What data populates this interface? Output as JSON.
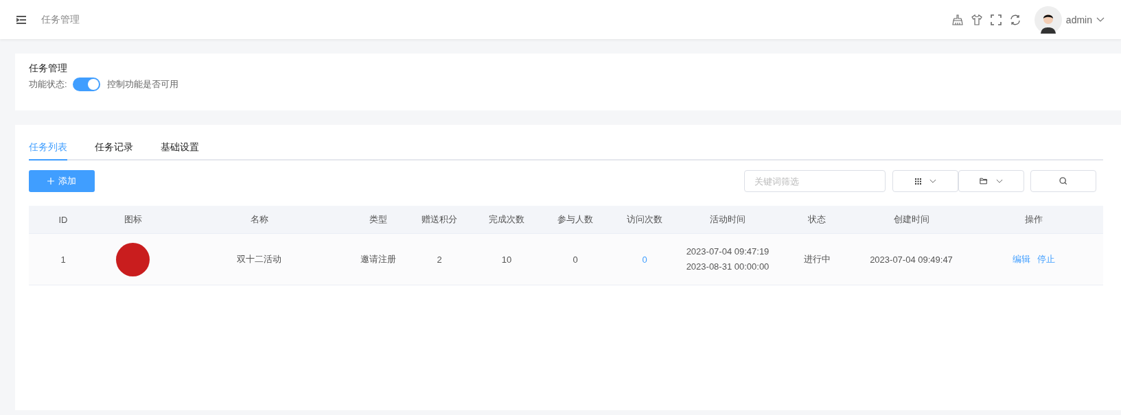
{
  "header": {
    "breadcrumb": "任务管理",
    "user": {
      "name": "admin"
    }
  },
  "module": {
    "title": "任务管理",
    "status_label": "功能状态:",
    "switch": {
      "on": true
    },
    "hint": "控制功能是否可用"
  },
  "tabs": [
    {
      "label": "任务列表",
      "selected": true
    },
    {
      "label": "任务记录",
      "selected": false
    },
    {
      "label": "基础设置",
      "selected": false
    }
  ],
  "toolbar": {
    "add_button": "添加",
    "search": {
      "placeholder": "关键词筛选"
    }
  },
  "table": {
    "columns": [
      "ID",
      "图标",
      "名称",
      "类型",
      "赠送积分",
      "完成次数",
      "参与人数",
      "访问次数",
      "活动时间",
      "状态",
      "创建时间",
      "操作"
    ],
    "rows": [
      {
        "id": "1",
        "name": "双十二活动",
        "type": "邀请注册",
        "points": "2",
        "completions": "10",
        "participants": "0",
        "visits": "0",
        "period": [
          "2023-07-04 09:47:19",
          "2023-08-31 00:00:00"
        ],
        "status": "进行中",
        "created": "2023-07-04 09:49:47",
        "actions": [
          "编辑",
          "停止"
        ]
      }
    ]
  }
}
